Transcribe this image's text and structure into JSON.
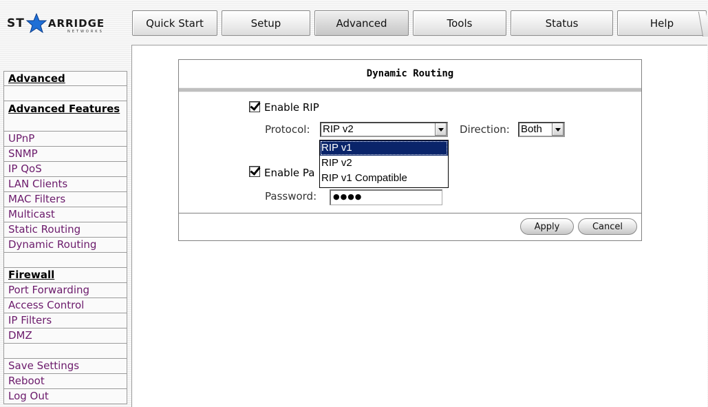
{
  "logo": {
    "text_left": "ST",
    "text_right": "ARRIDGE",
    "subtitle": "NETWORKS"
  },
  "tabs": [
    {
      "label": "Quick Start",
      "active": false
    },
    {
      "label": "Setup",
      "active": false
    },
    {
      "label": "Advanced",
      "active": true
    },
    {
      "label": "Tools",
      "active": false
    },
    {
      "label": "Status",
      "active": false
    },
    {
      "label": "Help",
      "active": false
    }
  ],
  "sidebar": {
    "title": "Advanced",
    "features_heading": "Advanced Features",
    "features": [
      "UPnP",
      "SNMP",
      "IP QoS",
      "LAN Clients",
      "MAC Filters",
      "Multicast",
      "Static Routing",
      "Dynamic Routing"
    ],
    "firewall_heading": "Firewall",
    "firewall": [
      "Port Forwarding",
      "Access Control",
      "IP Filters",
      "DMZ"
    ],
    "actions": [
      "Save Settings",
      "Reboot",
      "Log Out"
    ]
  },
  "panel": {
    "title": "Dynamic Routing",
    "enable_rip_label": "Enable RIP",
    "protocol_label": "Protocol:",
    "protocol_value": "RIP v2",
    "direction_label": "Direction:",
    "direction_value": "Both",
    "enable_password_label": "Enable Pa",
    "password_label": "Password:",
    "password_value": "●●●●",
    "protocol_options": [
      "RIP v1",
      "RIP v2",
      "RIP v1 Compatible"
    ],
    "apply_label": "Apply",
    "cancel_label": "Cancel"
  },
  "colors": {
    "link": "#6b1a6b",
    "selection": "#0a246a",
    "logo_star": "#1f6fd6"
  }
}
